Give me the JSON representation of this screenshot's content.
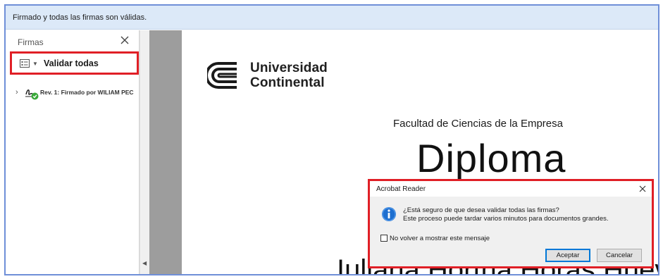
{
  "banner": {
    "text": "Firmado y todas las firmas son válidas."
  },
  "signatures_panel": {
    "title": "Firmas",
    "validate_all_label": "Validar todas",
    "signature_item": "Rev. 1: Firmado por WILIAM PEC"
  },
  "document": {
    "logo_line1": "Universidad",
    "logo_line2": "Continental",
    "faculty": "Facultad de Ciencias de la Empresa",
    "heading": "Diploma",
    "name_partial": "Iuliana Hortha Horas Huevos"
  },
  "dialog": {
    "title": "Acrobat Reader",
    "message_line1": "¿Está seguro de que desea validar todas las firmas?",
    "message_line2": "Este proceso puede tardar varios minutos para documentos grandes.",
    "checkbox_label": "No volver a mostrar este mensaje",
    "accept_label": "Aceptar",
    "cancel_label": "Cancelar"
  },
  "colors": {
    "highlight_border": "#e01f26",
    "banner_bg": "#dce9f8",
    "info_icon": "#1e6fd0",
    "valid_check": "#3aa93a"
  }
}
